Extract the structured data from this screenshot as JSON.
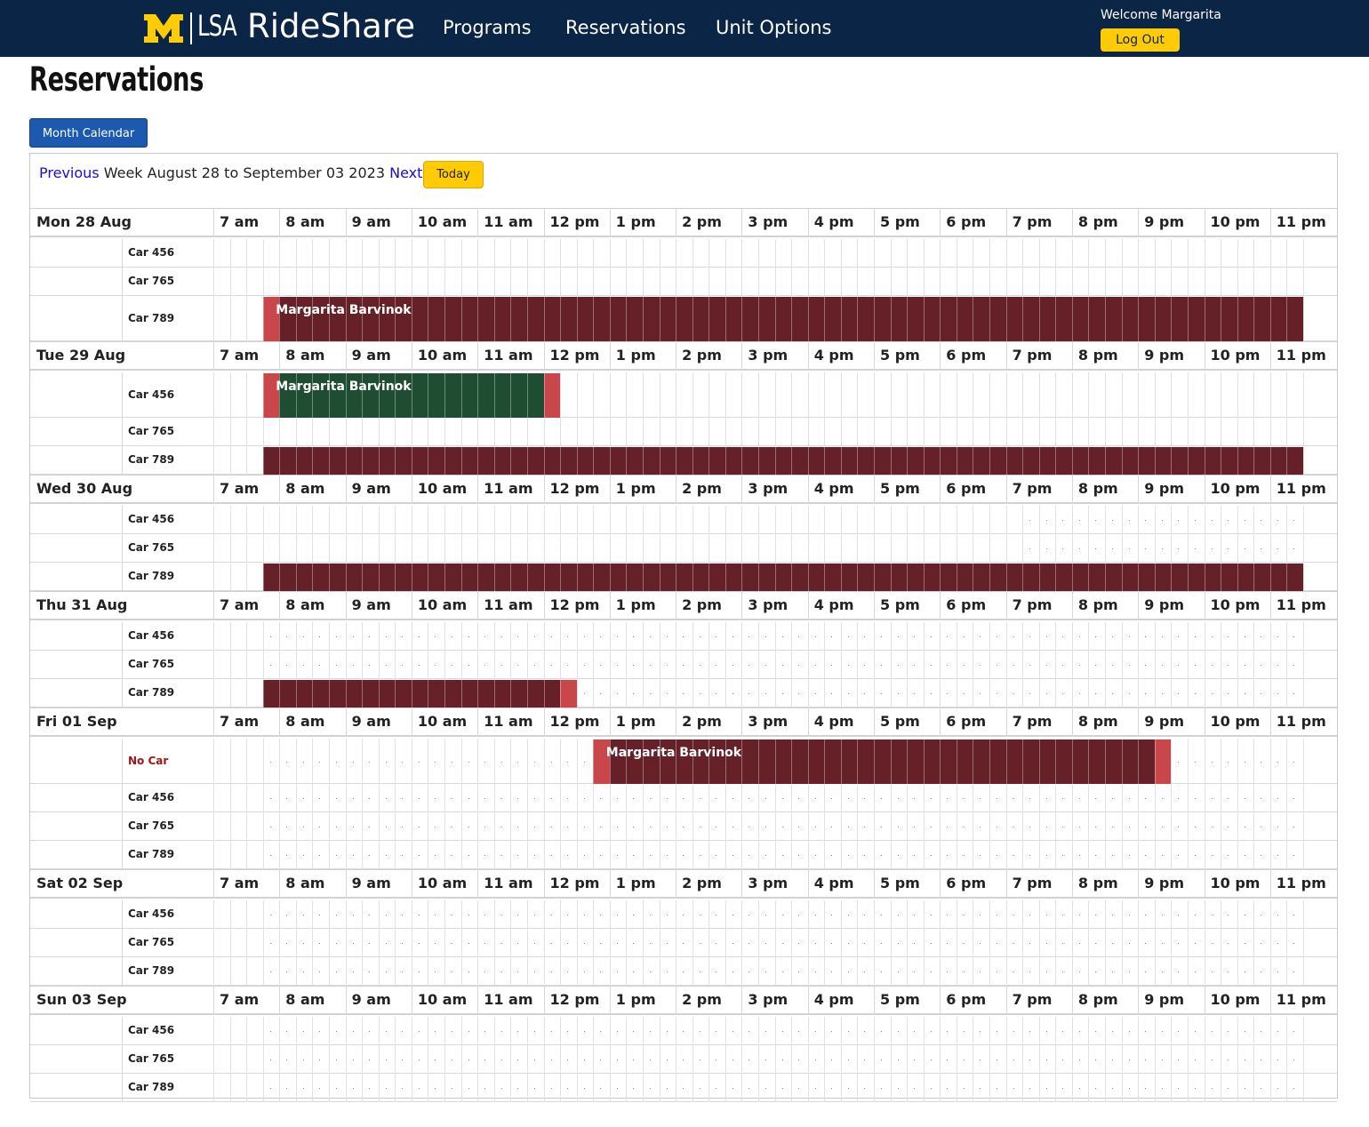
{
  "header": {
    "logo_m": "M",
    "logo_lsa": "LSA",
    "brand": "RideShare",
    "nav": [
      "Programs",
      "Reservations",
      "Unit Options"
    ],
    "welcome": "Welcome Margarita",
    "logout_label": "Log Out"
  },
  "page": {
    "title": "Reservations",
    "month_calendar_label": "Month Calendar",
    "prev_label": "Previous",
    "week_text": "Week August 28 to September 03 2023",
    "next_label": "Next",
    "today_label": "Today"
  },
  "colors": {
    "navbar": "#0b2547",
    "maize": "#ffcb05",
    "reserved_dark": "#652127",
    "reserved_edge": "#c9474b",
    "own_green": "#1e4d32"
  },
  "hours": [
    "7 am",
    "8 am",
    "9 am",
    "10 am",
    "11 am",
    "12 pm",
    "1 pm",
    "2 pm",
    "3 pm",
    "4 pm",
    "5 pm",
    "6 pm",
    "7 pm",
    "8 pm",
    "9 pm",
    "10 pm",
    "11 pm"
  ],
  "slots_per_hour": 4,
  "days": [
    {
      "label": "Mon 28 Aug",
      "cars": [
        {
          "name": "Car 456",
          "tall": false,
          "past_until": 68,
          "reservations": []
        },
        {
          "name": "Car 765",
          "tall": false,
          "past_until": 68,
          "reservations": []
        },
        {
          "name": "Car 789",
          "tall": true,
          "past_until": 68,
          "reservations": [
            {
              "start": 3,
              "end": 65,
              "color": "dark",
              "label": "Margarita Barvinok",
              "lead": 1,
              "tail": 0
            }
          ]
        }
      ]
    },
    {
      "label": "Tue 29 Aug",
      "cars": [
        {
          "name": "Car 456",
          "tall": true,
          "past_until": 68,
          "reservations": [
            {
              "start": 3,
              "end": 20,
              "color": "green",
              "label": "Margarita Barvinok",
              "lead": 1,
              "tail": 1
            }
          ]
        },
        {
          "name": "Car 765",
          "tall": false,
          "past_until": 68,
          "reservations": []
        },
        {
          "name": "Car 789",
          "tall": false,
          "past_until": 68,
          "reservations": [
            {
              "start": 3,
              "end": 65,
              "color": "dark",
              "label": "",
              "lead": 0,
              "tail": 0
            }
          ]
        }
      ]
    },
    {
      "label": "Wed 30 Aug",
      "cars": [
        {
          "name": "Car 456",
          "tall": false,
          "past_until": 49,
          "reservations": []
        },
        {
          "name": "Car 765",
          "tall": false,
          "past_until": 49,
          "reservations": []
        },
        {
          "name": "Car 789",
          "tall": false,
          "past_until": 68,
          "reservations": [
            {
              "start": 3,
              "end": 65,
              "color": "dark",
              "label": "",
              "lead": 0,
              "tail": 0
            }
          ]
        }
      ]
    },
    {
      "label": "Thu 31 Aug",
      "cars": [
        {
          "name": "Car 456",
          "tall": false,
          "past_until": 3,
          "reservations": []
        },
        {
          "name": "Car 765",
          "tall": false,
          "past_until": 3,
          "reservations": []
        },
        {
          "name": "Car 789",
          "tall": false,
          "past_until": 3,
          "reservations": [
            {
              "start": 3,
              "end": 21,
              "color": "dark",
              "label": "",
              "lead": 0,
              "tail": 1
            }
          ]
        }
      ]
    },
    {
      "label": "Fri 01 Sep",
      "cars": [
        {
          "name": "No Car",
          "tall": true,
          "nocar": true,
          "past_until": 3,
          "reservations": [
            {
              "start": 23,
              "end": 57,
              "color": "dark",
              "label": "Margarita Barvinok",
              "lead": 1,
              "tail": 1
            }
          ]
        },
        {
          "name": "Car 456",
          "tall": false,
          "past_until": 3,
          "reservations": []
        },
        {
          "name": "Car 765",
          "tall": false,
          "past_until": 3,
          "reservations": []
        },
        {
          "name": "Car 789",
          "tall": false,
          "past_until": 3,
          "reservations": []
        }
      ]
    },
    {
      "label": "Sat 02 Sep",
      "cars": [
        {
          "name": "Car 456",
          "tall": false,
          "past_until": 3,
          "reservations": []
        },
        {
          "name": "Car 765",
          "tall": false,
          "past_until": 3,
          "reservations": []
        },
        {
          "name": "Car 789",
          "tall": false,
          "past_until": 3,
          "reservations": []
        }
      ]
    },
    {
      "label": "Sun 03 Sep",
      "cars": [
        {
          "name": "Car 456",
          "tall": false,
          "past_until": 3,
          "reservations": []
        },
        {
          "name": "Car 765",
          "tall": false,
          "past_until": 3,
          "reservations": []
        },
        {
          "name": "Car 789",
          "tall": false,
          "past_until": 3,
          "reservations": []
        }
      ]
    }
  ]
}
